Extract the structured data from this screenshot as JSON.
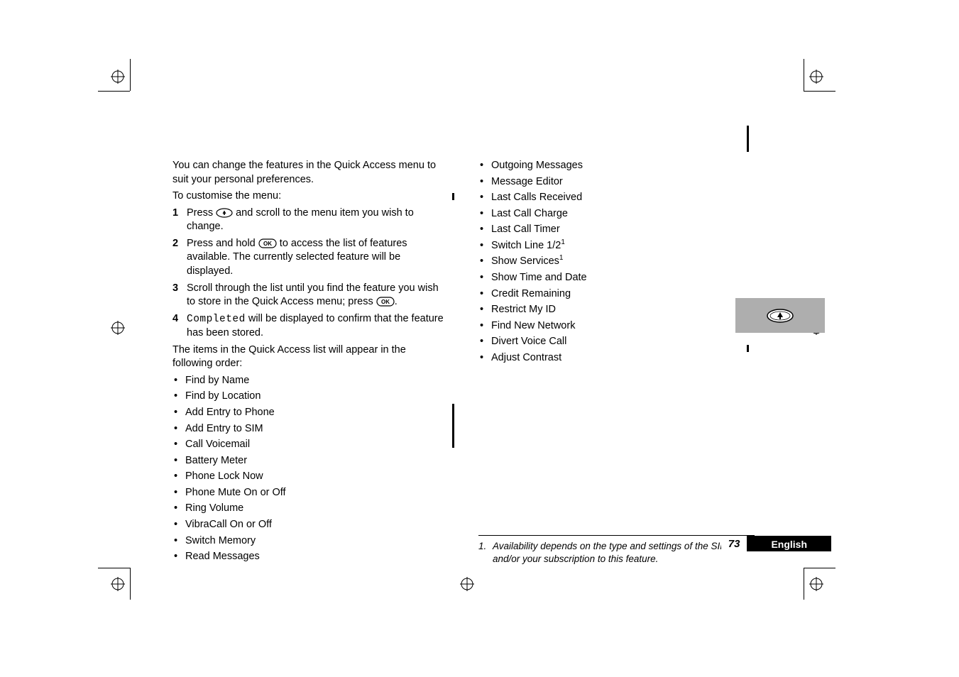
{
  "para_intro": "You can change the features in the Quick Access menu to suit your personal preferences.",
  "para_custom": "To customise the menu:",
  "steps": {
    "s1_a": "Press ",
    "s1_b": " and scroll to the menu item you wish to change.",
    "s2_a": "Press and hold ",
    "s2_b": " to access the list of features available. The currently selected feature will be displayed.",
    "s3_a": "Scroll through the list until you find the feature you wish to store in the Quick Access menu; press ",
    "s3_b": ".",
    "s4_a": "Completed",
    "s4_b": " will be displayed to confirm that the feature has been stored."
  },
  "para_list_intro": "The items in the Quick Access list will appear in the following order:",
  "left_items": [
    "Find by Name",
    "Find by Location",
    "Add Entry to Phone",
    "Add Entry to SIM",
    "Call Voicemail",
    "Battery Meter",
    "Phone Lock Now",
    "Phone Mute On or Off",
    "Ring Volume",
    "VibraCall On or Off",
    "Switch Memory",
    "Read Messages"
  ],
  "right_items_plain": [
    "Outgoing Messages",
    "Message Editor",
    "Last Calls Received",
    "Last Call Charge",
    "Last Call Timer"
  ],
  "right_item_switch": "Switch Line 1/2",
  "right_item_show": " Show Services",
  "right_items_tail": [
    "Show Time and Date",
    "Credit Remaining",
    "Restrict My ID",
    "Find New Network",
    "Divert Voice Call",
    "Adjust Contrast"
  ],
  "fn_marker": "1",
  "footnote_num": "1.",
  "footnote_text": "Availability depends on the type and settings of the SIM card, and/or your subscription to this feature.",
  "page_number": "73",
  "language": "English",
  "nums": {
    "n1": "1",
    "n2": "2",
    "n3": "3",
    "n4": "4"
  }
}
